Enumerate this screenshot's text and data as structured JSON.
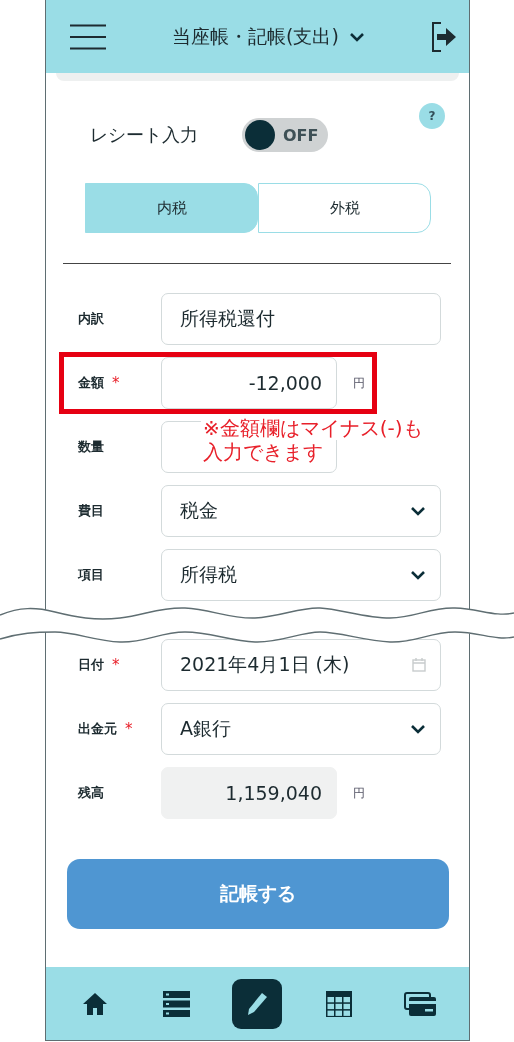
{
  "header": {
    "title": "当座帳・記帳(支出)"
  },
  "receipt_input": {
    "label": "レシート入力",
    "on": false,
    "state_text": "OFF"
  },
  "help_icon": "?",
  "tax_tabs": [
    {
      "label": "内税",
      "selected": true
    },
    {
      "label": "外税",
      "selected": false
    }
  ],
  "fields": [
    {
      "kind": "text",
      "label": "内訳",
      "value": "所得税還付"
    },
    {
      "kind": "amount",
      "label": "金額",
      "required_mark": "*",
      "highlighted": true,
      "value": "-12,000",
      "unit": "円"
    },
    {
      "kind": "short",
      "label": "数量"
    },
    {
      "kind": "select",
      "label": "費目",
      "value": "税金"
    },
    {
      "kind": "select",
      "label": "項目",
      "value": "所得税"
    }
  ],
  "note": [
    "※金額欄はマイナス(-)も",
    "入力できます"
  ],
  "fields_after_break": [
    {
      "kind": "date",
      "label": "日付",
      "required_mark": "*",
      "value": "2021年4月1日 (木)"
    },
    {
      "kind": "select",
      "label": "出金元",
      "required_mark": "*",
      "value": "A銀行"
    },
    {
      "kind": "readonly",
      "label": "残高",
      "value": "1,159,040",
      "unit": "円"
    }
  ],
  "submit_button": "記帳する",
  "nav": [
    {
      "kind": "home",
      "selected": false
    },
    {
      "kind": "list",
      "selected": false
    },
    {
      "kind": "pencil",
      "selected": true
    },
    {
      "kind": "table",
      "selected": false
    },
    {
      "kind": "card",
      "selected": false
    }
  ]
}
